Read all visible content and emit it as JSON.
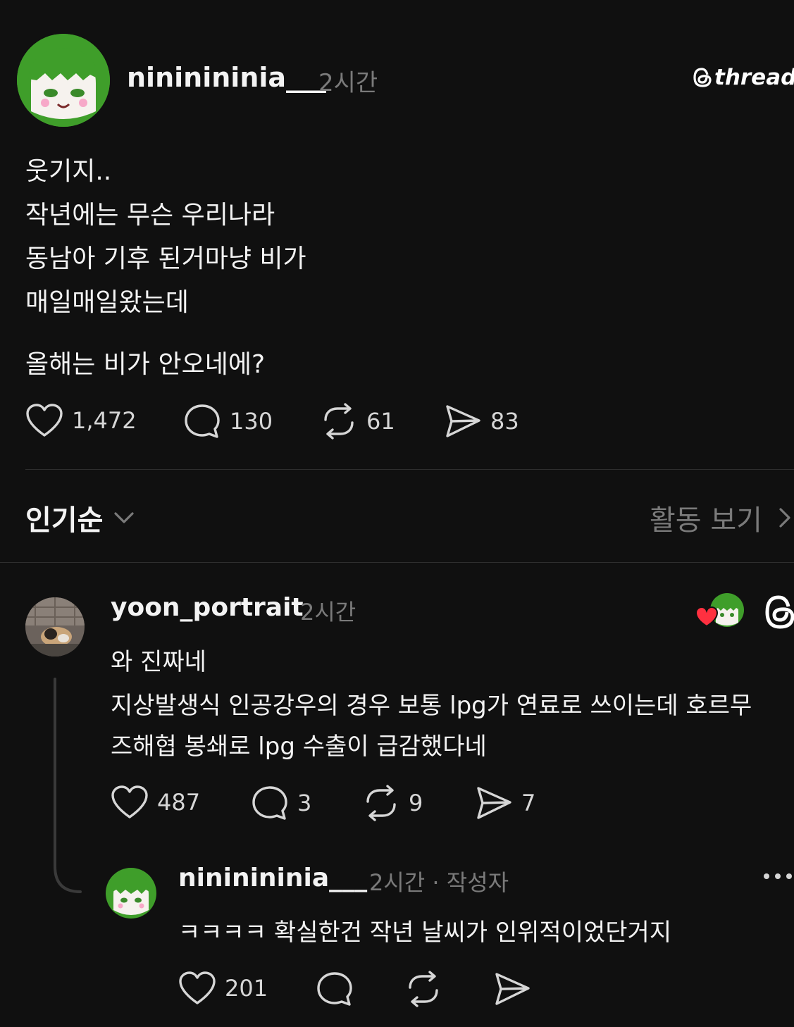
{
  "post": {
    "username": "nininininia___",
    "time": "2시간",
    "brand": "threads",
    "lines": [
      "웃기지..",
      "작년에는 무슨 우리나라",
      "동남아 기후 된거마냥 비가",
      "매일매일왔는데",
      "올해는 비가 안오네에?"
    ],
    "stats": {
      "likes": "1,472",
      "comments": "130",
      "reposts": "61",
      "shares": "83"
    }
  },
  "sort": {
    "label": "인기순",
    "activity": "활동 보기"
  },
  "comment": {
    "username": "yoon_portrait",
    "time": "2시간",
    "lines": [
      "와 진짜네",
      "지상발생식 인공강우의 경우 보통 lpg가 연료로 쓰이는데 호르무",
      "즈해협 봉쇄로 lpg 수출이 급감했다네"
    ],
    "stats": {
      "likes": "487",
      "comments": "3",
      "reposts": "9",
      "shares": "7"
    }
  },
  "reply": {
    "username": "nininininia___",
    "time": "2시간 · 작성자",
    "text": "ㅋㅋㅋㅋ 확실한건 작년 날씨가 인위적이었단거지",
    "stats": {
      "likes": "201"
    }
  },
  "colors": {
    "background": "#101010",
    "text": "#f3f3f3",
    "muted": "#7a7a7a",
    "avatar_green": "#3f9e2a",
    "heart_red": "#ff3040"
  }
}
